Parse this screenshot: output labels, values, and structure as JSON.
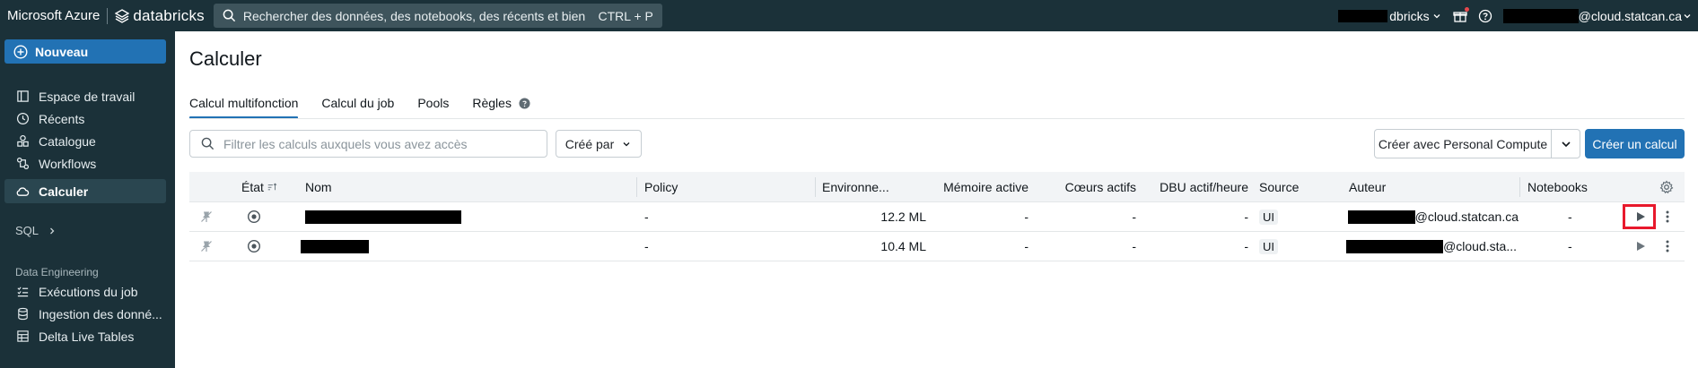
{
  "topbar": {
    "brand_ms": "Microsoft Azure",
    "brand_db": "databricks",
    "search_placeholder": "Rechercher des données, des notebooks, des récents et bien plus ...",
    "search_shortcut": "CTRL + P",
    "workspace_suffix": "dbricks",
    "user_suffix": "@cloud.statcan.ca",
    "icons": [
      "search-icon",
      "chevron-down-icon",
      "gift-icon",
      "help-icon"
    ]
  },
  "sidebar": {
    "new_label": "Nouveau",
    "items": [
      {
        "label": "Espace de travail",
        "icon": "workspace-icon"
      },
      {
        "label": "Récents",
        "icon": "clock-icon"
      },
      {
        "label": "Catalogue",
        "icon": "catalog-icon"
      },
      {
        "label": "Workflows",
        "icon": "workflows-icon"
      },
      {
        "label": "Calculer",
        "icon": "cloud-icon",
        "active": true
      }
    ],
    "sql_label": "SQL",
    "section_label": "Data Engineering",
    "de_items": [
      {
        "label": "Exécutions du job",
        "icon": "runs-icon"
      },
      {
        "label": "Ingestion des donné...",
        "icon": "ingestion-icon"
      },
      {
        "label": "Delta Live Tables",
        "icon": "dlt-icon"
      }
    ]
  },
  "page": {
    "title": "Calculer",
    "tabs": [
      {
        "label": "Calcul multifonction",
        "active": true
      },
      {
        "label": "Calcul du job"
      },
      {
        "label": "Pools"
      },
      {
        "label": "Règles"
      }
    ],
    "filter_placeholder": "Filtrer les calculs auxquels vous avez accès",
    "created_by_label": "Créé par",
    "personal_compute_label": "Créer avec Personal Compute",
    "create_label": "Créer un calcul"
  },
  "table": {
    "columns": {
      "state": "État",
      "name": "Nom",
      "policy": "Policy",
      "environment": "Environne...",
      "active_memory": "Mémoire active",
      "active_cores": "Cœurs actifs",
      "dbu": "DBU actif/heure",
      "source": "Source",
      "author": "Auteur",
      "notebooks": "Notebooks"
    },
    "rows": [
      {
        "policy": "-",
        "environment": "12.2 ML",
        "active_memory": "-",
        "active_cores": "-",
        "dbu": "-",
        "source": "UI",
        "author_suffix": "@cloud.statcan.ca",
        "notebooks": "-",
        "highlighted": true
      },
      {
        "policy": "-",
        "environment": "10.4 ML",
        "active_memory": "-",
        "active_cores": "-",
        "dbu": "-",
        "source": "UI",
        "author_suffix": "@cloud.sta...",
        "notebooks": "-",
        "highlighted": false
      }
    ]
  },
  "colors": {
    "topbar_bg": "#1b3139",
    "accent": "#2272b4",
    "highlight": "#e8192c"
  }
}
